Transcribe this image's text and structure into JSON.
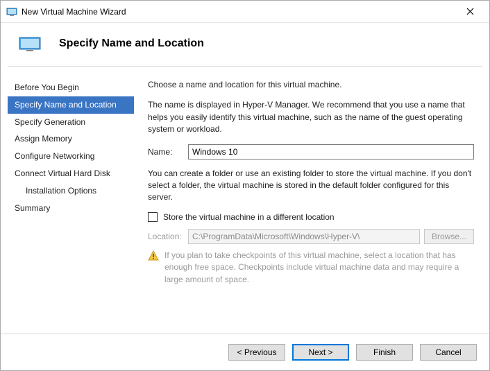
{
  "titlebar": {
    "text": "New Virtual Machine Wizard"
  },
  "header": {
    "title": "Specify Name and Location"
  },
  "sidebar": {
    "steps": [
      "Before You Begin",
      "Specify Name and Location",
      "Specify Generation",
      "Assign Memory",
      "Configure Networking",
      "Connect Virtual Hard Disk",
      "Installation Options",
      "Summary"
    ]
  },
  "content": {
    "intro": "Choose a name and location for this virtual machine.",
    "desc": "The name is displayed in Hyper-V Manager. We recommend that you use a name that helps you easily identify this virtual machine, such as the name of the guest operating system or workload.",
    "name_label": "Name:",
    "name_value": "Windows 10",
    "folder_desc": "You can create a folder or use an existing folder to store the virtual machine. If you don't select a folder, the virtual machine is stored in the default folder configured for this server.",
    "checkbox_label": "Store the virtual machine in a different location",
    "location_label": "Location:",
    "location_value": "C:\\ProgramData\\Microsoft\\Windows\\Hyper-V\\",
    "browse_label": "Browse...",
    "warning": "If you plan to take checkpoints of this virtual machine, select a location that has enough free space. Checkpoints include virtual machine data and may require a large amount of space."
  },
  "footer": {
    "previous": "< Previous",
    "next": "Next >",
    "finish": "Finish",
    "cancel": "Cancel"
  }
}
